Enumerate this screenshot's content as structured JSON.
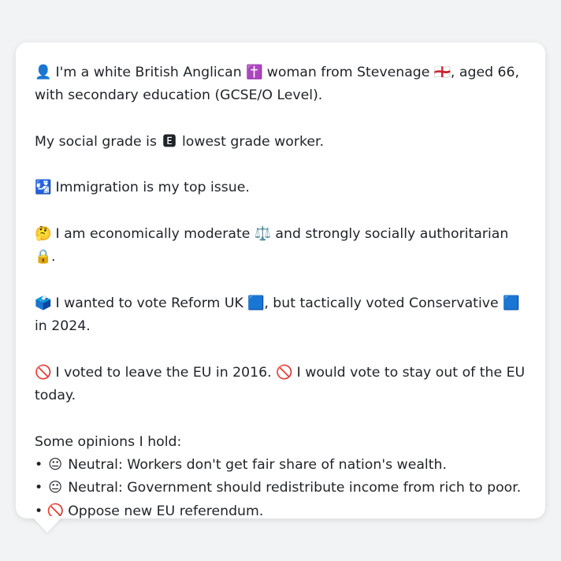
{
  "profile": {
    "identity": {
      "icon": "👤",
      "text_before_religion_icon": "I'm a white British Anglican",
      "religion_icon": "✝️",
      "text_before_place_icon": "woman from Stevenage",
      "place_icon": "🏴󠁧󠁢󠁥󠁮󠁧󠁿",
      "text_after_place_icon": ", aged 66, with secondary education (GCSE/O Level)."
    },
    "social_grade": {
      "text_before_grade_icon": "My social grade is",
      "grade_icon": "🅴",
      "text_after_grade_icon": "lowest grade worker."
    },
    "top_issue": {
      "icon": "🛂",
      "text": "Immigration is my top issue."
    },
    "ideology": {
      "icon": "🤔",
      "text_before_econ_icon": "I am economically moderate",
      "econ_icon": "⚖️",
      "text_before_social_icon": "and strongly socially authoritarian",
      "social_icon": "🔒",
      "text_after_social_icon": "."
    },
    "vote_2024": {
      "icon": "🗳️",
      "text_before_party1_icon": "I wanted to vote Reform UK",
      "party1_icon": "🟦",
      "text_before_party2_icon": ", but tactically voted Conservative",
      "party2_icon": "🟦",
      "text_after_party2_icon": "in 2024."
    },
    "eu": {
      "icon1": "🚫",
      "text1": "I voted to leave the EU in 2016.",
      "icon2": "🚫",
      "text2": "I would vote to stay out of the EU today."
    },
    "opinions": {
      "heading": "Some opinions I hold:",
      "items": [
        {
          "icon": "😐",
          "text": "Neutral: Workers don't get fair share of nation's wealth."
        },
        {
          "icon": "😐",
          "text": "Neutral: Government should redistribute income from rich to poor."
        },
        {
          "icon": "🚫",
          "text": "Oppose new EU referendum."
        }
      ]
    }
  }
}
